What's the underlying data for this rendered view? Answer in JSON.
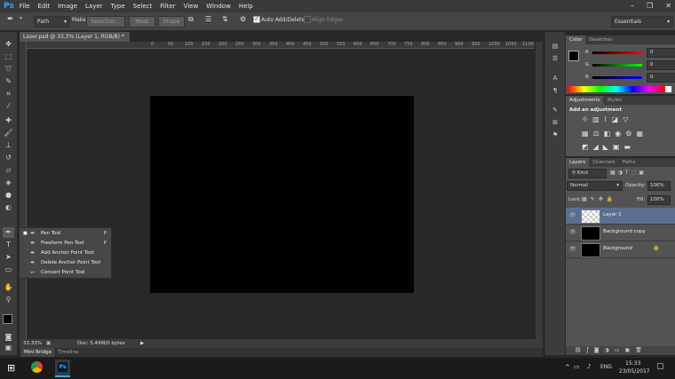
{
  "app": {
    "logo": "Ps"
  },
  "menu": [
    "File",
    "Edit",
    "Image",
    "Layer",
    "Type",
    "Select",
    "Filter",
    "View",
    "Window",
    "Help"
  ],
  "window_controls": [
    "–",
    "❐",
    "✕"
  ],
  "options_bar": {
    "mode_value": "Path",
    "make_label": "Make:",
    "selection_btn": "Selection...",
    "mask_btn": "Mask",
    "shape_btn": "Shape",
    "auto_add_delete": "Auto Add/Delete",
    "align_edges": "Align Edges",
    "workspace": "Essentials"
  },
  "document": {
    "tab_title": "Laser.psd @ 33.3% (Layer 1, RGB/8) *",
    "ruler_top": [
      "0",
      "50",
      "100",
      "150",
      "200",
      "250",
      "300",
      "350",
      "400",
      "450",
      "500",
      "550",
      "600",
      "650",
      "700",
      "750",
      "800",
      "850",
      "900",
      "950",
      "1000",
      "1050",
      "1100",
      "1150",
      "1200",
      "1250"
    ],
    "zoom": "33.33%",
    "doc_info": "Doc: 5.49M/0 bytes"
  },
  "bottom_tabs": [
    "Mini Bridge",
    "Timeline"
  ],
  "tool_flyout": [
    {
      "label": "Pen Tool",
      "shortcut": "P",
      "selected": true
    },
    {
      "label": "Freeform Pen Tool",
      "shortcut": "P",
      "selected": false
    },
    {
      "label": "Add Anchor Point Tool",
      "shortcut": "",
      "selected": false
    },
    {
      "label": "Delete Anchor Point Tool",
      "shortcut": "",
      "selected": false
    },
    {
      "label": "Convert Point Tool",
      "shortcut": "",
      "selected": false
    }
  ],
  "color_panel": {
    "tabs": [
      "Color",
      "Swatches"
    ],
    "channels": [
      {
        "name": "R",
        "value": "0"
      },
      {
        "name": "G",
        "value": "0"
      },
      {
        "name": "B",
        "value": "0"
      }
    ]
  },
  "adjustments_panel": {
    "tabs": [
      "Adjustments",
      "Styles"
    ],
    "heading": "Add an adjustment"
  },
  "layers_panel": {
    "tabs": [
      "Layers",
      "Channels",
      "Paths"
    ],
    "kind": "Kind",
    "blend_mode": "Normal",
    "opacity_label": "Opacity:",
    "opacity": "100%",
    "lock_label": "Lock:",
    "fill_label": "Fill:",
    "fill": "100%",
    "layers": [
      {
        "name": "Layer 1",
        "selected": true
      },
      {
        "name": "Background copy",
        "selected": false
      },
      {
        "name": "Background",
        "selected": false
      }
    ]
  },
  "taskbar": {
    "language": "ENG",
    "time": "15:33",
    "date": "23/05/2017"
  },
  "colors": {
    "accent": "#31a8ff",
    "selected_layer": "#5a6f8f",
    "canvas": "#000000"
  }
}
